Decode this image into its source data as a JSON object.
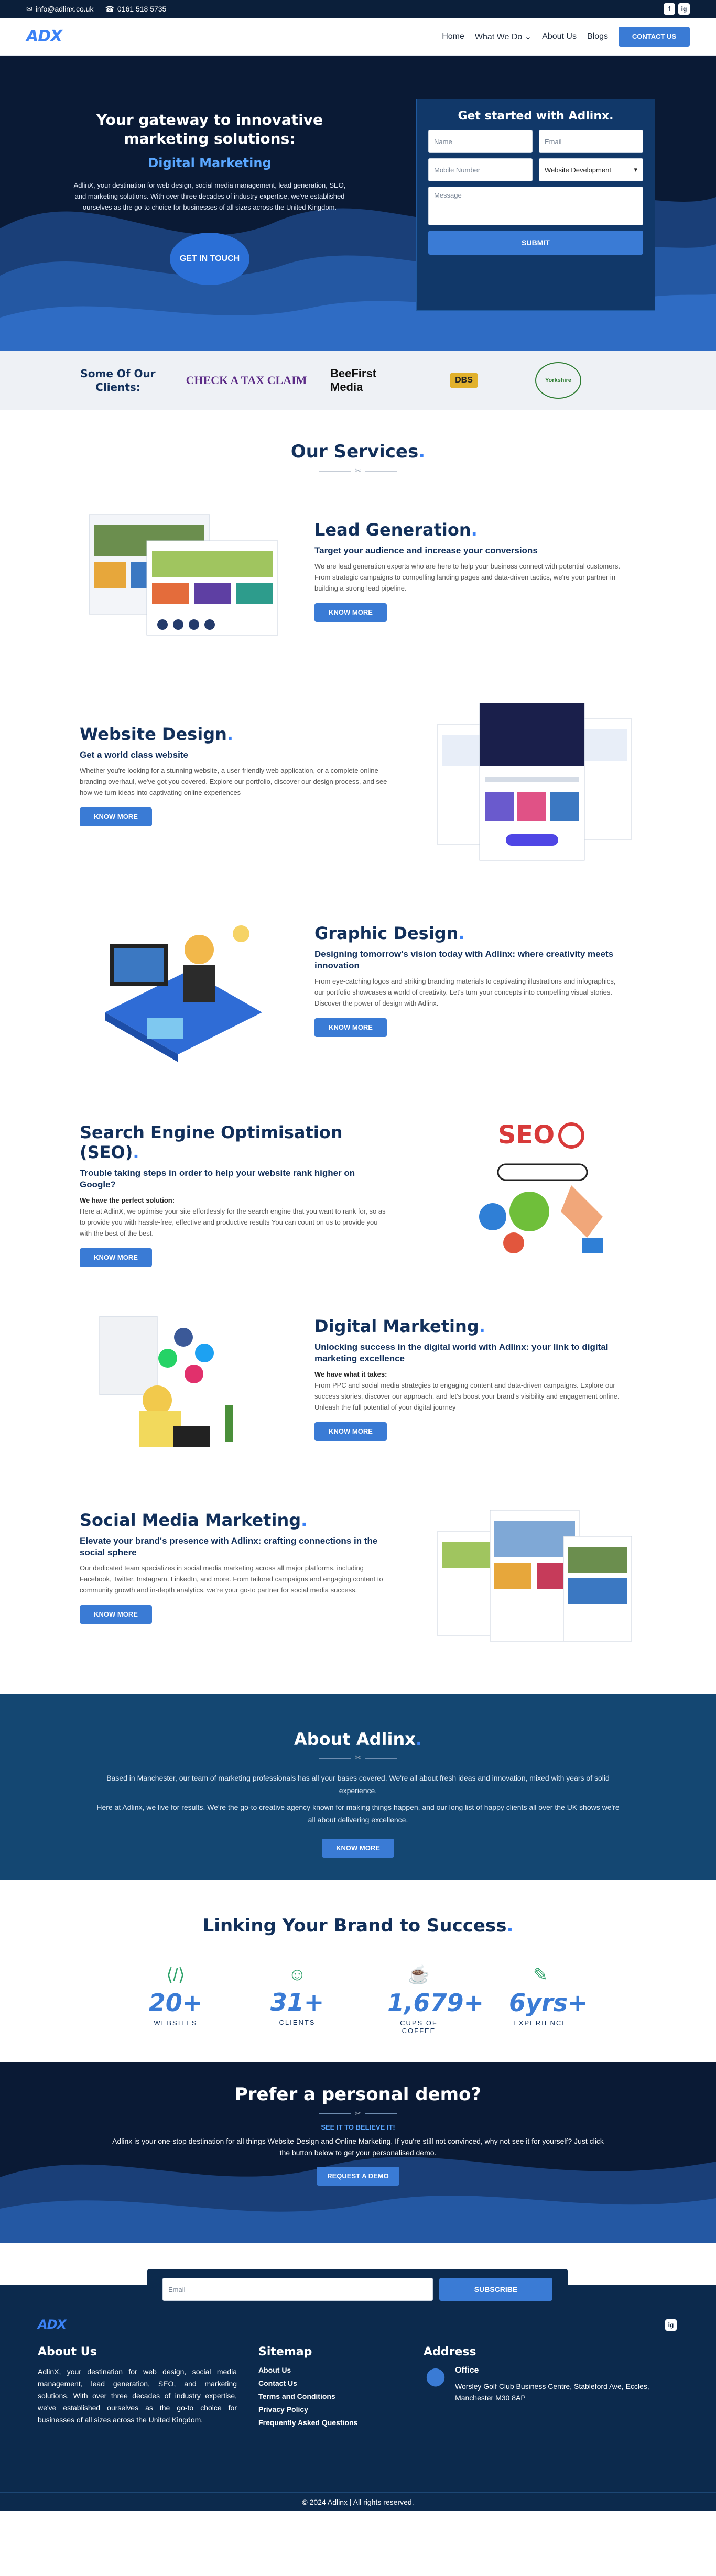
{
  "topbar": {
    "email": "info@adlinx.co.uk",
    "phone": "0161 518 5735",
    "social": [
      "f",
      "ig"
    ]
  },
  "nav": {
    "logo": "ADX",
    "items": [
      "Home",
      "What We Do",
      "About Us",
      "Blogs"
    ],
    "contact": "CONTACT US"
  },
  "hero": {
    "title": "Your gateway to innovative marketing solutions:",
    "subtitle": "Digital Marketing",
    "text": "AdlinX, your destination for web design, social media management, lead generation, SEO, and marketing solutions. With over three decades of industry expertise, we've established ourselves as the go-to choice for businesses of all sizes across the United Kingdom.",
    "cta": "GET IN TOUCH",
    "form": {
      "title": "Get started with Adlinx.",
      "name": "Name",
      "email": "Email",
      "mobile": "Mobile Number",
      "service": "Website Development",
      "message": "Message",
      "submit": "SUBMIT"
    }
  },
  "clients": {
    "label": "Some Of Our Clients:",
    "logos": [
      "CHECK A TAX CLAIM",
      "BeeFirst Media",
      "DBS",
      "Yorkshire"
    ]
  },
  "services": {
    "title": "Our Services",
    "more": "KNOW MORE",
    "items": [
      {
        "title": "Lead Generation",
        "headline": "Target your audience and increase your conversions",
        "text": "We are lead generation experts who are here to help your business connect with potential customers. From strategic campaigns to compelling landing pages and data-driven tactics, we're your partner in building a strong lead pipeline."
      },
      {
        "title": "Website Design",
        "headline": "Get a world class website",
        "text": "Whether you're looking for a stunning website, a user-friendly web application, or a complete online branding overhaul, we've got you covered. Explore our portfolio, discover our design process, and see how we turn ideas into captivating online experiences"
      },
      {
        "title": "Graphic Design",
        "headline": "Designing tomorrow's vision today with Adlinx: where creativity meets innovation",
        "text": "From eye-catching logos and striking branding materials to captivating illustrations and infographics, our portfolio showcases a world of creativity. Let's turn your concepts into compelling visual stories. Discover the power of design with Adlinx."
      },
      {
        "title": "Search Engine Optimisation (SEO)",
        "headline": "Trouble taking steps in order to help your website rank higher on Google?",
        "lead": "We have the perfect solution:",
        "text": "Here at AdlinX, we optimise your site effortlessly for the search engine that you want to rank for, so as to provide you with hassle-free, effective and productive results You can count on us to provide you with the best of the best."
      },
      {
        "title": "Digital Marketing",
        "headline": "Unlocking success in the digital world with Adlinx: your link to digital marketing excellence",
        "lead": "We have what it takes:",
        "text": "From PPC and social media strategies to engaging content and data-driven campaigns. Explore our success stories, discover our approach, and let's boost your brand's visibility and engagement online. Unleash the full potential of your digital journey"
      },
      {
        "title": "Social Media Marketing",
        "headline": "Elevate your brand's presence with Adlinx: crafting connections in the social sphere",
        "text": "Our dedicated team specializes in social media marketing across all major platforms, including Facebook, Twitter, Instagram, LinkedIn, and more. From tailored campaigns and engaging content to community growth and in-depth analytics, we're your go-to partner for social media success."
      }
    ]
  },
  "about": {
    "title": "About Adlinx",
    "p1": "Based in Manchester, our team of marketing professionals has all your bases covered. We're all about fresh ideas and innovation, mixed with years of solid experience.",
    "p2": "Here at Adlinx, we live for results. We're the go-to creative agency known for making things happen, and our long list of happy clients all over the UK shows we're all about delivering excellence.",
    "button": "KNOW MORE"
  },
  "stats": {
    "title": "Linking Your Brand to Success",
    "items": [
      {
        "num": "20+",
        "label": "WEBSITES"
      },
      {
        "num": "31+",
        "label": "CLIENTS"
      },
      {
        "num": "1,679+",
        "label": "CUPS OF COFFEE"
      },
      {
        "num": "6yrs+",
        "label": "EXPERIENCE"
      }
    ]
  },
  "demo": {
    "title": "Prefer a personal demo?",
    "sub": "SEE IT TO BELIEVE IT!",
    "text": "Adlinx is your one-stop destination for all things Website Design and Online Marketing. If you're still not convinced, why not see it for yourself? Just click the button below to get your personalised demo.",
    "button": "REQUEST A DEMO"
  },
  "newsletter": {
    "placeholder": "Email",
    "button": "SUBSCRIBE"
  },
  "footer": {
    "about_title": "About Us",
    "about_text": "AdlinX, your destination for web design, social media management, lead generation, SEO, and marketing solutions. With over three decades of industry expertise, we've established ourselves as the go-to choice for businesses of all sizes across the United Kingdom.",
    "sitemap_title": "Sitemap",
    "links": [
      "About Us",
      "Contact Us",
      "Terms and Conditions",
      "Privacy Policy",
      "Frequently Asked Questions"
    ],
    "address_title": "Address",
    "office": "Office",
    "address": "Worsley Golf Club Business Centre, Stableford Ave, Eccles, Manchester M30 8AP",
    "copyright": "© 2024 Adlinx | All rights reserved."
  },
  "colors": {
    "navy": "#0a1a35",
    "accent": "#3a7bd5",
    "title": "#12305b",
    "about_bg": "#144772"
  }
}
